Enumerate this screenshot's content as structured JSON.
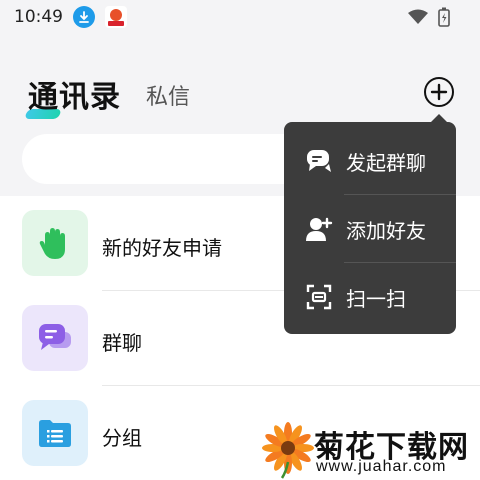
{
  "status_bar": {
    "time": "10:49",
    "icons": [
      "download-icon",
      "app-notification-icon",
      "wifi-icon",
      "battery-icon"
    ]
  },
  "header": {
    "tabs": [
      {
        "label": "通讯录",
        "active": true
      },
      {
        "label": "私信",
        "active": false
      }
    ],
    "accent_color": "#2ecfc4"
  },
  "contact_list": {
    "items": [
      {
        "label": "新的好友申请",
        "icon": "hand-wave-icon",
        "icon_bg": "#e3f6e8"
      },
      {
        "label": "群聊",
        "icon": "chat-bubbles-icon",
        "icon_bg": "#ece6fb"
      },
      {
        "label": "分组",
        "icon": "folder-icon",
        "icon_bg": "#dff0fb"
      }
    ]
  },
  "popup_menu": {
    "items": [
      {
        "label": "发起群聊",
        "icon": "group-chat-icon"
      },
      {
        "label": "添加好友",
        "icon": "add-user-icon"
      },
      {
        "label": "扫一扫",
        "icon": "scan-icon"
      }
    ]
  },
  "watermark": {
    "title": "菊花下载网",
    "url": "www.juahar.com"
  }
}
